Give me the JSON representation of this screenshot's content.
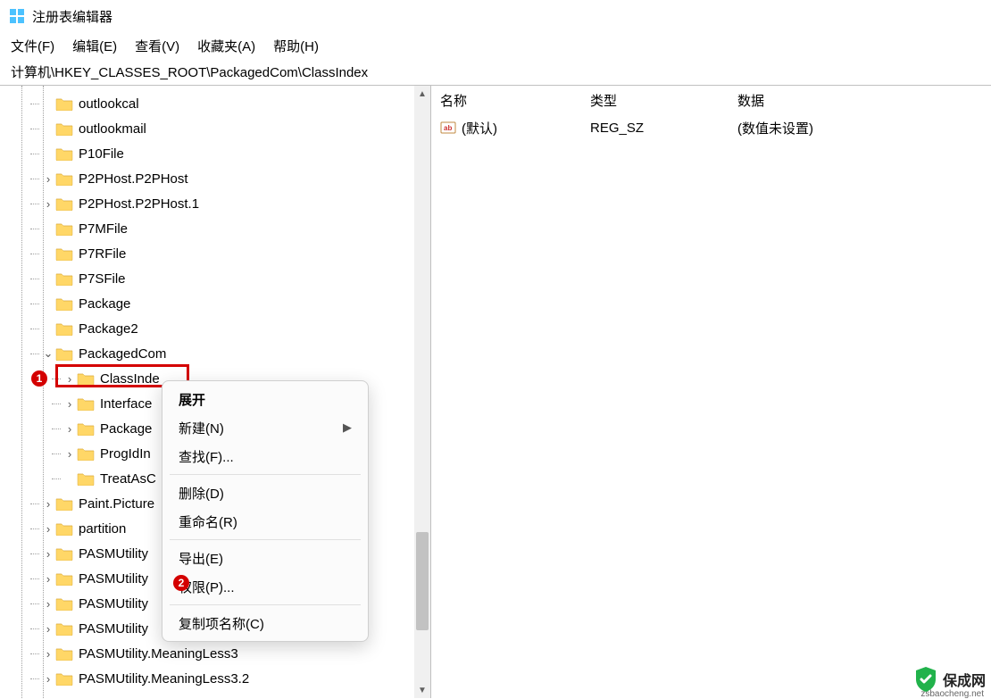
{
  "window": {
    "title": "注册表编辑器"
  },
  "menu": {
    "file": "文件(F)",
    "edit": "编辑(E)",
    "view": "查看(V)",
    "favorites": "收藏夹(A)",
    "help": "帮助(H)"
  },
  "address": "计算机\\HKEY_CLASSES_ROOT\\PackagedCom\\ClassIndex",
  "columns": {
    "name": "名称",
    "type": "类型",
    "data": "数据"
  },
  "values_row": {
    "name": "(默认)",
    "type": "REG_SZ",
    "data": "(数值未设置)"
  },
  "tree": {
    "items": [
      {
        "label": "outlookcal",
        "depth": 1,
        "expander": ""
      },
      {
        "label": "outlookmail",
        "depth": 1,
        "expander": ""
      },
      {
        "label": "P10File",
        "depth": 1,
        "expander": ""
      },
      {
        "label": "P2PHost.P2PHost",
        "depth": 1,
        "expander": ">"
      },
      {
        "label": "P2PHost.P2PHost.1",
        "depth": 1,
        "expander": ">"
      },
      {
        "label": "P7MFile",
        "depth": 1,
        "expander": ""
      },
      {
        "label": "P7RFile",
        "depth": 1,
        "expander": ""
      },
      {
        "label": "P7SFile",
        "depth": 1,
        "expander": ""
      },
      {
        "label": "Package",
        "depth": 1,
        "expander": ""
      },
      {
        "label": "Package2",
        "depth": 1,
        "expander": ""
      },
      {
        "label": "PackagedCom",
        "depth": 1,
        "expander": "v"
      },
      {
        "label": "ClassInde",
        "depth": 2,
        "expander": ">",
        "selected": true
      },
      {
        "label": "Interface",
        "depth": 2,
        "expander": ">"
      },
      {
        "label": "Package",
        "depth": 2,
        "expander": ">"
      },
      {
        "label": "ProgIdIn",
        "depth": 2,
        "expander": ">"
      },
      {
        "label": "TreatAsC",
        "depth": 2,
        "expander": ""
      },
      {
        "label": "Paint.Picture",
        "depth": 1,
        "expander": ">"
      },
      {
        "label": "partition",
        "depth": 1,
        "expander": ">"
      },
      {
        "label": "PASMUtility",
        "depth": 1,
        "expander": ">"
      },
      {
        "label": "PASMUtility",
        "depth": 1,
        "expander": ">"
      },
      {
        "label": "PASMUtility",
        "depth": 1,
        "expander": ">"
      },
      {
        "label": "PASMUtility",
        "depth": 1,
        "expander": ">"
      },
      {
        "label": "PASMUtility.MeaningLess3",
        "depth": 1,
        "expander": ">"
      },
      {
        "label": "PASMUtility.MeaningLess3.2",
        "depth": 1,
        "expander": ">"
      }
    ]
  },
  "context_menu": {
    "expand": "展开",
    "new": "新建(N)",
    "find": "查找(F)...",
    "delete": "删除(D)",
    "rename": "重命名(R)",
    "export": "导出(E)",
    "permissions": "权限(P)...",
    "copy_key_name": "复制项名称(C)"
  },
  "annotations": {
    "badge1": "1",
    "badge2": "2"
  },
  "watermark": {
    "brand": "保成网",
    "url": "zsbaocheng.net"
  }
}
